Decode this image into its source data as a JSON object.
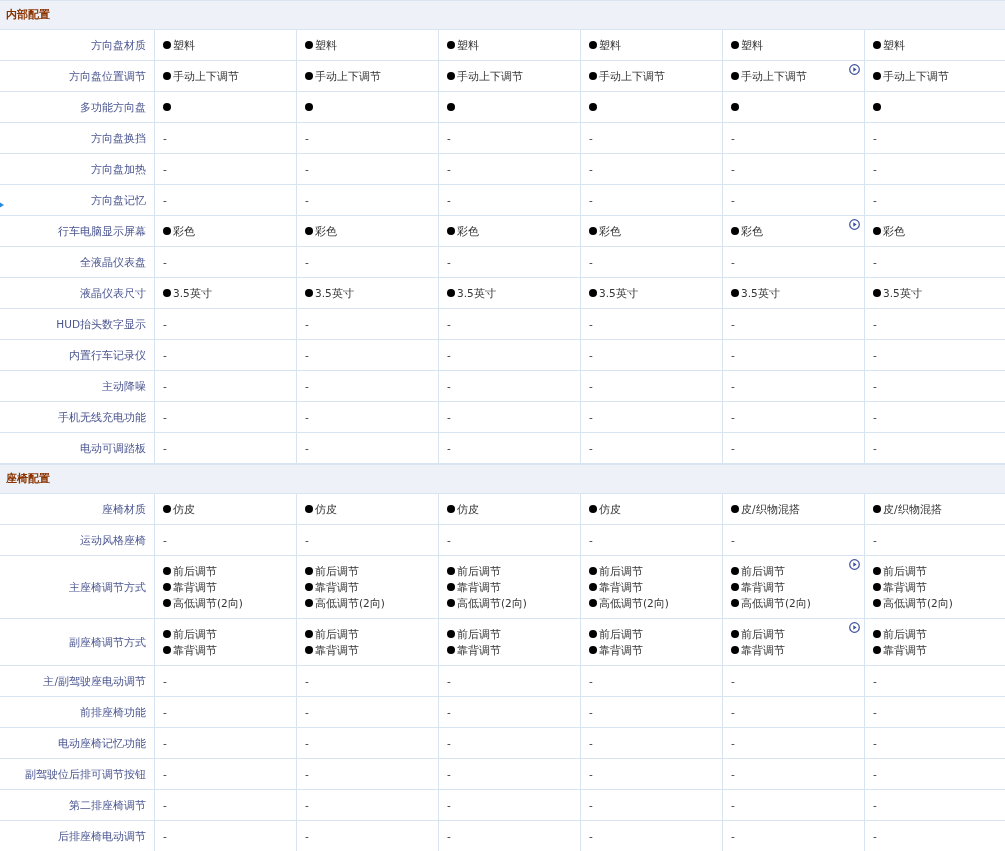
{
  "sections": [
    {
      "title": "内部配置",
      "rows": [
        {
          "label": "方向盘材质",
          "cells": [
            {
              "play": false,
              "lines": [
                {
                  "dot": true,
                  "text": "塑料"
                }
              ]
            },
            {
              "play": false,
              "lines": [
                {
                  "dot": true,
                  "text": "塑料"
                }
              ]
            },
            {
              "play": false,
              "lines": [
                {
                  "dot": true,
                  "text": "塑料"
                }
              ]
            },
            {
              "play": false,
              "lines": [
                {
                  "dot": true,
                  "text": "塑料"
                }
              ]
            },
            {
              "play": false,
              "lines": [
                {
                  "dot": true,
                  "text": "塑料"
                }
              ]
            },
            {
              "play": false,
              "lines": [
                {
                  "dot": true,
                  "text": "塑料"
                }
              ]
            }
          ]
        },
        {
          "label": "方向盘位置调节",
          "cells": [
            {
              "play": false,
              "lines": [
                {
                  "dot": true,
                  "text": "手动上下调节"
                }
              ]
            },
            {
              "play": false,
              "lines": [
                {
                  "dot": true,
                  "text": "手动上下调节"
                }
              ]
            },
            {
              "play": false,
              "lines": [
                {
                  "dot": true,
                  "text": "手动上下调节"
                }
              ]
            },
            {
              "play": false,
              "lines": [
                {
                  "dot": true,
                  "text": "手动上下调节"
                }
              ]
            },
            {
              "play": true,
              "lines": [
                {
                  "dot": true,
                  "text": "手动上下调节"
                }
              ]
            },
            {
              "play": false,
              "lines": [
                {
                  "dot": true,
                  "text": "手动上下调节"
                }
              ]
            }
          ]
        },
        {
          "label": "多功能方向盘",
          "cells": [
            {
              "play": false,
              "lines": [
                {
                  "dot": true
                }
              ]
            },
            {
              "play": false,
              "lines": [
                {
                  "dot": true
                }
              ]
            },
            {
              "play": false,
              "lines": [
                {
                  "dot": true
                }
              ]
            },
            {
              "play": false,
              "lines": [
                {
                  "dot": true
                }
              ]
            },
            {
              "play": false,
              "lines": [
                {
                  "dot": true
                }
              ]
            },
            {
              "play": false,
              "lines": [
                {
                  "dot": true
                }
              ]
            }
          ]
        },
        {
          "label": "方向盘换挡",
          "cells": [
            {
              "play": false,
              "lines": [
                {
                  "dot": false,
                  "text": "-"
                }
              ]
            },
            {
              "play": false,
              "lines": [
                {
                  "dot": false,
                  "text": "-"
                }
              ]
            },
            {
              "play": false,
              "lines": [
                {
                  "dot": false,
                  "text": "-"
                }
              ]
            },
            {
              "play": false,
              "lines": [
                {
                  "dot": false,
                  "text": "-"
                }
              ]
            },
            {
              "play": false,
              "lines": [
                {
                  "dot": false,
                  "text": "-"
                }
              ]
            },
            {
              "play": false,
              "lines": [
                {
                  "dot": false,
                  "text": "-"
                }
              ]
            }
          ]
        },
        {
          "label": "方向盘加热",
          "cells": [
            {
              "play": false,
              "lines": [
                {
                  "dot": false,
                  "text": "-"
                }
              ]
            },
            {
              "play": false,
              "lines": [
                {
                  "dot": false,
                  "text": "-"
                }
              ]
            },
            {
              "play": false,
              "lines": [
                {
                  "dot": false,
                  "text": "-"
                }
              ]
            },
            {
              "play": false,
              "lines": [
                {
                  "dot": false,
                  "text": "-"
                }
              ]
            },
            {
              "play": false,
              "lines": [
                {
                  "dot": false,
                  "text": "-"
                }
              ]
            },
            {
              "play": false,
              "lines": [
                {
                  "dot": false,
                  "text": "-"
                }
              ]
            }
          ]
        },
        {
          "label": "方向盘记忆",
          "cells": [
            {
              "play": false,
              "lines": [
                {
                  "dot": false,
                  "text": "-"
                }
              ]
            },
            {
              "play": false,
              "lines": [
                {
                  "dot": false,
                  "text": "-"
                }
              ]
            },
            {
              "play": false,
              "lines": [
                {
                  "dot": false,
                  "text": "-"
                }
              ]
            },
            {
              "play": false,
              "lines": [
                {
                  "dot": false,
                  "text": "-"
                }
              ]
            },
            {
              "play": false,
              "lines": [
                {
                  "dot": false,
                  "text": "-"
                }
              ]
            },
            {
              "play": false,
              "lines": [
                {
                  "dot": false,
                  "text": "-"
                }
              ]
            }
          ]
        },
        {
          "label": "行车电脑显示屏幕",
          "cells": [
            {
              "play": false,
              "lines": [
                {
                  "dot": true,
                  "text": "彩色"
                }
              ]
            },
            {
              "play": false,
              "lines": [
                {
                  "dot": true,
                  "text": "彩色"
                }
              ]
            },
            {
              "play": false,
              "lines": [
                {
                  "dot": true,
                  "text": "彩色"
                }
              ]
            },
            {
              "play": false,
              "lines": [
                {
                  "dot": true,
                  "text": "彩色"
                }
              ]
            },
            {
              "play": true,
              "lines": [
                {
                  "dot": true,
                  "text": "彩色"
                }
              ]
            },
            {
              "play": false,
              "lines": [
                {
                  "dot": true,
                  "text": "彩色"
                }
              ]
            }
          ]
        },
        {
          "label": "全液晶仪表盘",
          "cells": [
            {
              "play": false,
              "lines": [
                {
                  "dot": false,
                  "text": "-"
                }
              ]
            },
            {
              "play": false,
              "lines": [
                {
                  "dot": false,
                  "text": "-"
                }
              ]
            },
            {
              "play": false,
              "lines": [
                {
                  "dot": false,
                  "text": "-"
                }
              ]
            },
            {
              "play": false,
              "lines": [
                {
                  "dot": false,
                  "text": "-"
                }
              ]
            },
            {
              "play": false,
              "lines": [
                {
                  "dot": false,
                  "text": "-"
                }
              ]
            },
            {
              "play": false,
              "lines": [
                {
                  "dot": false,
                  "text": "-"
                }
              ]
            }
          ]
        },
        {
          "label": "液晶仪表尺寸",
          "cells": [
            {
              "play": false,
              "lines": [
                {
                  "dot": true,
                  "text": "3.5英寸"
                }
              ]
            },
            {
              "play": false,
              "lines": [
                {
                  "dot": true,
                  "text": "3.5英寸"
                }
              ]
            },
            {
              "play": false,
              "lines": [
                {
                  "dot": true,
                  "text": "3.5英寸"
                }
              ]
            },
            {
              "play": false,
              "lines": [
                {
                  "dot": true,
                  "text": "3.5英寸"
                }
              ]
            },
            {
              "play": false,
              "lines": [
                {
                  "dot": true,
                  "text": "3.5英寸"
                }
              ]
            },
            {
              "play": false,
              "lines": [
                {
                  "dot": true,
                  "text": "3.5英寸"
                }
              ]
            }
          ]
        },
        {
          "label": "HUD抬头数字显示",
          "cells": [
            {
              "play": false,
              "lines": [
                {
                  "dot": false,
                  "text": "-"
                }
              ]
            },
            {
              "play": false,
              "lines": [
                {
                  "dot": false,
                  "text": "-"
                }
              ]
            },
            {
              "play": false,
              "lines": [
                {
                  "dot": false,
                  "text": "-"
                }
              ]
            },
            {
              "play": false,
              "lines": [
                {
                  "dot": false,
                  "text": "-"
                }
              ]
            },
            {
              "play": false,
              "lines": [
                {
                  "dot": false,
                  "text": "-"
                }
              ]
            },
            {
              "play": false,
              "lines": [
                {
                  "dot": false,
                  "text": "-"
                }
              ]
            }
          ]
        },
        {
          "label": "内置行车记录仪",
          "cells": [
            {
              "play": false,
              "lines": [
                {
                  "dot": false,
                  "text": "-"
                }
              ]
            },
            {
              "play": false,
              "lines": [
                {
                  "dot": false,
                  "text": "-"
                }
              ]
            },
            {
              "play": false,
              "lines": [
                {
                  "dot": false,
                  "text": "-"
                }
              ]
            },
            {
              "play": false,
              "lines": [
                {
                  "dot": false,
                  "text": "-"
                }
              ]
            },
            {
              "play": false,
              "lines": [
                {
                  "dot": false,
                  "text": "-"
                }
              ]
            },
            {
              "play": false,
              "lines": [
                {
                  "dot": false,
                  "text": "-"
                }
              ]
            }
          ]
        },
        {
          "label": "主动降噪",
          "cells": [
            {
              "play": false,
              "lines": [
                {
                  "dot": false,
                  "text": "-"
                }
              ]
            },
            {
              "play": false,
              "lines": [
                {
                  "dot": false,
                  "text": "-"
                }
              ]
            },
            {
              "play": false,
              "lines": [
                {
                  "dot": false,
                  "text": "-"
                }
              ]
            },
            {
              "play": false,
              "lines": [
                {
                  "dot": false,
                  "text": "-"
                }
              ]
            },
            {
              "play": false,
              "lines": [
                {
                  "dot": false,
                  "text": "-"
                }
              ]
            },
            {
              "play": false,
              "lines": [
                {
                  "dot": false,
                  "text": "-"
                }
              ]
            }
          ]
        },
        {
          "label": "手机无线充电功能",
          "cells": [
            {
              "play": false,
              "lines": [
                {
                  "dot": false,
                  "text": "-"
                }
              ]
            },
            {
              "play": false,
              "lines": [
                {
                  "dot": false,
                  "text": "-"
                }
              ]
            },
            {
              "play": false,
              "lines": [
                {
                  "dot": false,
                  "text": "-"
                }
              ]
            },
            {
              "play": false,
              "lines": [
                {
                  "dot": false,
                  "text": "-"
                }
              ]
            },
            {
              "play": false,
              "lines": [
                {
                  "dot": false,
                  "text": "-"
                }
              ]
            },
            {
              "play": false,
              "lines": [
                {
                  "dot": false,
                  "text": "-"
                }
              ]
            }
          ]
        },
        {
          "label": "电动可调踏板",
          "cells": [
            {
              "play": false,
              "lines": [
                {
                  "dot": false,
                  "text": "-"
                }
              ]
            },
            {
              "play": false,
              "lines": [
                {
                  "dot": false,
                  "text": "-"
                }
              ]
            },
            {
              "play": false,
              "lines": [
                {
                  "dot": false,
                  "text": "-"
                }
              ]
            },
            {
              "play": false,
              "lines": [
                {
                  "dot": false,
                  "text": "-"
                }
              ]
            },
            {
              "play": false,
              "lines": [
                {
                  "dot": false,
                  "text": "-"
                }
              ]
            },
            {
              "play": false,
              "lines": [
                {
                  "dot": false,
                  "text": "-"
                }
              ]
            }
          ]
        }
      ]
    },
    {
      "title": "座椅配置",
      "rows": [
        {
          "label": "座椅材质",
          "cells": [
            {
              "play": false,
              "lines": [
                {
                  "dot": true,
                  "text": "仿皮"
                }
              ]
            },
            {
              "play": false,
              "lines": [
                {
                  "dot": true,
                  "text": "仿皮"
                }
              ]
            },
            {
              "play": false,
              "lines": [
                {
                  "dot": true,
                  "text": "仿皮"
                }
              ]
            },
            {
              "play": false,
              "lines": [
                {
                  "dot": true,
                  "text": "仿皮"
                }
              ]
            },
            {
              "play": false,
              "lines": [
                {
                  "dot": true,
                  "text": "皮/织物混搭"
                }
              ]
            },
            {
              "play": false,
              "lines": [
                {
                  "dot": true,
                  "text": "皮/织物混搭"
                }
              ]
            }
          ]
        },
        {
          "label": "运动风格座椅",
          "cells": [
            {
              "play": false,
              "lines": [
                {
                  "dot": false,
                  "text": "-"
                }
              ]
            },
            {
              "play": false,
              "lines": [
                {
                  "dot": false,
                  "text": "-"
                }
              ]
            },
            {
              "play": false,
              "lines": [
                {
                  "dot": false,
                  "text": "-"
                }
              ]
            },
            {
              "play": false,
              "lines": [
                {
                  "dot": false,
                  "text": "-"
                }
              ]
            },
            {
              "play": false,
              "lines": [
                {
                  "dot": false,
                  "text": "-"
                }
              ]
            },
            {
              "play": false,
              "lines": [
                {
                  "dot": false,
                  "text": "-"
                }
              ]
            }
          ]
        },
        {
          "label": "主座椅调节方式",
          "cells": [
            {
              "play": false,
              "lines": [
                {
                  "dot": true,
                  "text": "前后调节"
                },
                {
                  "dot": true,
                  "text": "靠背调节"
                },
                {
                  "dot": true,
                  "text": "高低调节(2向)"
                }
              ]
            },
            {
              "play": false,
              "lines": [
                {
                  "dot": true,
                  "text": "前后调节"
                },
                {
                  "dot": true,
                  "text": "靠背调节"
                },
                {
                  "dot": true,
                  "text": "高低调节(2向)"
                }
              ]
            },
            {
              "play": false,
              "lines": [
                {
                  "dot": true,
                  "text": "前后调节"
                },
                {
                  "dot": true,
                  "text": "靠背调节"
                },
                {
                  "dot": true,
                  "text": "高低调节(2向)"
                }
              ]
            },
            {
              "play": false,
              "lines": [
                {
                  "dot": true,
                  "text": "前后调节"
                },
                {
                  "dot": true,
                  "text": "靠背调节"
                },
                {
                  "dot": true,
                  "text": "高低调节(2向)"
                }
              ]
            },
            {
              "play": true,
              "lines": [
                {
                  "dot": true,
                  "text": "前后调节"
                },
                {
                  "dot": true,
                  "text": "靠背调节"
                },
                {
                  "dot": true,
                  "text": "高低调节(2向)"
                }
              ]
            },
            {
              "play": false,
              "lines": [
                {
                  "dot": true,
                  "text": "前后调节"
                },
                {
                  "dot": true,
                  "text": "靠背调节"
                },
                {
                  "dot": true,
                  "text": "高低调节(2向)"
                }
              ]
            }
          ]
        },
        {
          "label": "副座椅调节方式",
          "cells": [
            {
              "play": false,
              "lines": [
                {
                  "dot": true,
                  "text": "前后调节"
                },
                {
                  "dot": true,
                  "text": "靠背调节"
                }
              ]
            },
            {
              "play": false,
              "lines": [
                {
                  "dot": true,
                  "text": "前后调节"
                },
                {
                  "dot": true,
                  "text": "靠背调节"
                }
              ]
            },
            {
              "play": false,
              "lines": [
                {
                  "dot": true,
                  "text": "前后调节"
                },
                {
                  "dot": true,
                  "text": "靠背调节"
                }
              ]
            },
            {
              "play": false,
              "lines": [
                {
                  "dot": true,
                  "text": "前后调节"
                },
                {
                  "dot": true,
                  "text": "靠背调节"
                }
              ]
            },
            {
              "play": true,
              "lines": [
                {
                  "dot": true,
                  "text": "前后调节"
                },
                {
                  "dot": true,
                  "text": "靠背调节"
                }
              ]
            },
            {
              "play": false,
              "lines": [
                {
                  "dot": true,
                  "text": "前后调节"
                },
                {
                  "dot": true,
                  "text": "靠背调节"
                }
              ]
            }
          ]
        },
        {
          "label": "主/副驾驶座电动调节",
          "cells": [
            {
              "play": false,
              "lines": [
                {
                  "dot": false,
                  "text": "-"
                }
              ]
            },
            {
              "play": false,
              "lines": [
                {
                  "dot": false,
                  "text": "-"
                }
              ]
            },
            {
              "play": false,
              "lines": [
                {
                  "dot": false,
                  "text": "-"
                }
              ]
            },
            {
              "play": false,
              "lines": [
                {
                  "dot": false,
                  "text": "-"
                }
              ]
            },
            {
              "play": false,
              "lines": [
                {
                  "dot": false,
                  "text": "-"
                }
              ]
            },
            {
              "play": false,
              "lines": [
                {
                  "dot": false,
                  "text": "-"
                }
              ]
            }
          ]
        },
        {
          "label": "前排座椅功能",
          "cells": [
            {
              "play": false,
              "lines": [
                {
                  "dot": false,
                  "text": "-"
                }
              ]
            },
            {
              "play": false,
              "lines": [
                {
                  "dot": false,
                  "text": "-"
                }
              ]
            },
            {
              "play": false,
              "lines": [
                {
                  "dot": false,
                  "text": "-"
                }
              ]
            },
            {
              "play": false,
              "lines": [
                {
                  "dot": false,
                  "text": "-"
                }
              ]
            },
            {
              "play": false,
              "lines": [
                {
                  "dot": false,
                  "text": "-"
                }
              ]
            },
            {
              "play": false,
              "lines": [
                {
                  "dot": false,
                  "text": "-"
                }
              ]
            }
          ]
        },
        {
          "label": "电动座椅记忆功能",
          "cells": [
            {
              "play": false,
              "lines": [
                {
                  "dot": false,
                  "text": "-"
                }
              ]
            },
            {
              "play": false,
              "lines": [
                {
                  "dot": false,
                  "text": "-"
                }
              ]
            },
            {
              "play": false,
              "lines": [
                {
                  "dot": false,
                  "text": "-"
                }
              ]
            },
            {
              "play": false,
              "lines": [
                {
                  "dot": false,
                  "text": "-"
                }
              ]
            },
            {
              "play": false,
              "lines": [
                {
                  "dot": false,
                  "text": "-"
                }
              ]
            },
            {
              "play": false,
              "lines": [
                {
                  "dot": false,
                  "text": "-"
                }
              ]
            }
          ]
        },
        {
          "label": "副驾驶位后排可调节按钮",
          "cells": [
            {
              "play": false,
              "lines": [
                {
                  "dot": false,
                  "text": "-"
                }
              ]
            },
            {
              "play": false,
              "lines": [
                {
                  "dot": false,
                  "text": "-"
                }
              ]
            },
            {
              "play": false,
              "lines": [
                {
                  "dot": false,
                  "text": "-"
                }
              ]
            },
            {
              "play": false,
              "lines": [
                {
                  "dot": false,
                  "text": "-"
                }
              ]
            },
            {
              "play": false,
              "lines": [
                {
                  "dot": false,
                  "text": "-"
                }
              ]
            },
            {
              "play": false,
              "lines": [
                {
                  "dot": false,
                  "text": "-"
                }
              ]
            }
          ]
        },
        {
          "label": "第二排座椅调节",
          "cells": [
            {
              "play": false,
              "lines": [
                {
                  "dot": false,
                  "text": "-"
                }
              ]
            },
            {
              "play": false,
              "lines": [
                {
                  "dot": false,
                  "text": "-"
                }
              ]
            },
            {
              "play": false,
              "lines": [
                {
                  "dot": false,
                  "text": "-"
                }
              ]
            },
            {
              "play": false,
              "lines": [
                {
                  "dot": false,
                  "text": "-"
                }
              ]
            },
            {
              "play": false,
              "lines": [
                {
                  "dot": false,
                  "text": "-"
                }
              ]
            },
            {
              "play": false,
              "lines": [
                {
                  "dot": false,
                  "text": "-"
                }
              ]
            }
          ]
        },
        {
          "label": "后排座椅电动调节",
          "cells": [
            {
              "play": false,
              "lines": [
                {
                  "dot": false,
                  "text": "-"
                }
              ]
            },
            {
              "play": false,
              "lines": [
                {
                  "dot": false,
                  "text": "-"
                }
              ]
            },
            {
              "play": false,
              "lines": [
                {
                  "dot": false,
                  "text": "-"
                }
              ]
            },
            {
              "play": false,
              "lines": [
                {
                  "dot": false,
                  "text": "-"
                }
              ]
            },
            {
              "play": false,
              "lines": [
                {
                  "dot": false,
                  "text": "-"
                }
              ]
            },
            {
              "play": false,
              "lines": [
                {
                  "dot": false,
                  "text": "-"
                }
              ]
            }
          ]
        }
      ]
    }
  ]
}
